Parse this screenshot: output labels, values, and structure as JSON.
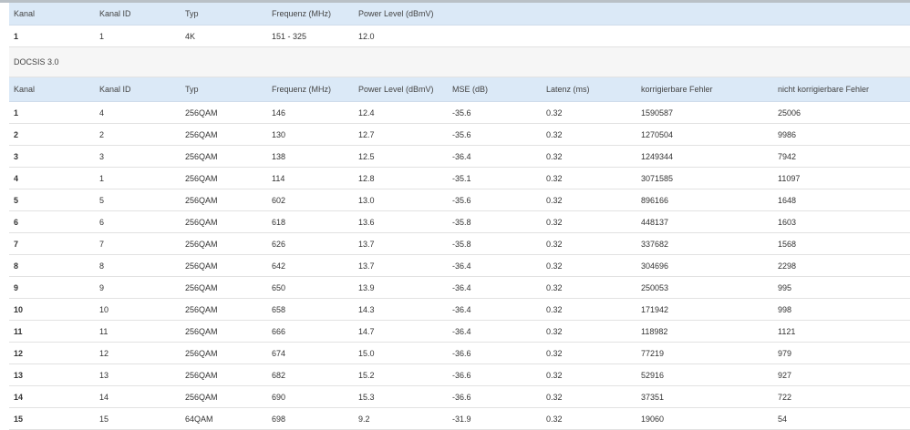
{
  "upstream_table": {
    "headers": [
      "Kanal",
      "Kanal ID",
      "Typ",
      "Frequenz (MHz)",
      "Power Level (dBmV)"
    ],
    "rows": [
      [
        "1",
        "1",
        "4K",
        "151 - 325",
        "12.0"
      ]
    ]
  },
  "docsis_section": {
    "label": "DOCSIS 3.0"
  },
  "docsis_table": {
    "headers": [
      "Kanal",
      "Kanal ID",
      "Typ",
      "Frequenz (MHz)",
      "Power Level (dBmV)",
      "MSE (dB)",
      "Latenz (ms)",
      "korrigierbare Fehler",
      "nicht korrigierbare Fehler"
    ],
    "rows": [
      [
        "1",
        "4",
        "256QAM",
        "146",
        "12.4",
        "-35.6",
        "0.32",
        "1590587",
        "25006"
      ],
      [
        "2",
        "2",
        "256QAM",
        "130",
        "12.7",
        "-35.6",
        "0.32",
        "1270504",
        "9986"
      ],
      [
        "3",
        "3",
        "256QAM",
        "138",
        "12.5",
        "-36.4",
        "0.32",
        "1249344",
        "7942"
      ],
      [
        "4",
        "1",
        "256QAM",
        "114",
        "12.8",
        "-35.1",
        "0.32",
        "3071585",
        "11097"
      ],
      [
        "5",
        "5",
        "256QAM",
        "602",
        "13.0",
        "-35.6",
        "0.32",
        "896166",
        "1648"
      ],
      [
        "6",
        "6",
        "256QAM",
        "618",
        "13.6",
        "-35.8",
        "0.32",
        "448137",
        "1603"
      ],
      [
        "7",
        "7",
        "256QAM",
        "626",
        "13.7",
        "-35.8",
        "0.32",
        "337682",
        "1568"
      ],
      [
        "8",
        "8",
        "256QAM",
        "642",
        "13.7",
        "-36.4",
        "0.32",
        "304696",
        "2298"
      ],
      [
        "9",
        "9",
        "256QAM",
        "650",
        "13.9",
        "-36.4",
        "0.32",
        "250053",
        "995"
      ],
      [
        "10",
        "10",
        "256QAM",
        "658",
        "14.3",
        "-36.4",
        "0.32",
        "171942",
        "998"
      ],
      [
        "11",
        "11",
        "256QAM",
        "666",
        "14.7",
        "-36.4",
        "0.32",
        "118982",
        "1121"
      ],
      [
        "12",
        "12",
        "256QAM",
        "674",
        "15.0",
        "-36.6",
        "0.32",
        "77219",
        "979"
      ],
      [
        "13",
        "13",
        "256QAM",
        "682",
        "15.2",
        "-36.6",
        "0.32",
        "52916",
        "927"
      ],
      [
        "14",
        "14",
        "256QAM",
        "690",
        "15.3",
        "-36.6",
        "0.32",
        "37351",
        "722"
      ],
      [
        "15",
        "15",
        "64QAM",
        "698",
        "9.2",
        "-31.9",
        "0.32",
        "19060",
        "54"
      ]
    ]
  }
}
